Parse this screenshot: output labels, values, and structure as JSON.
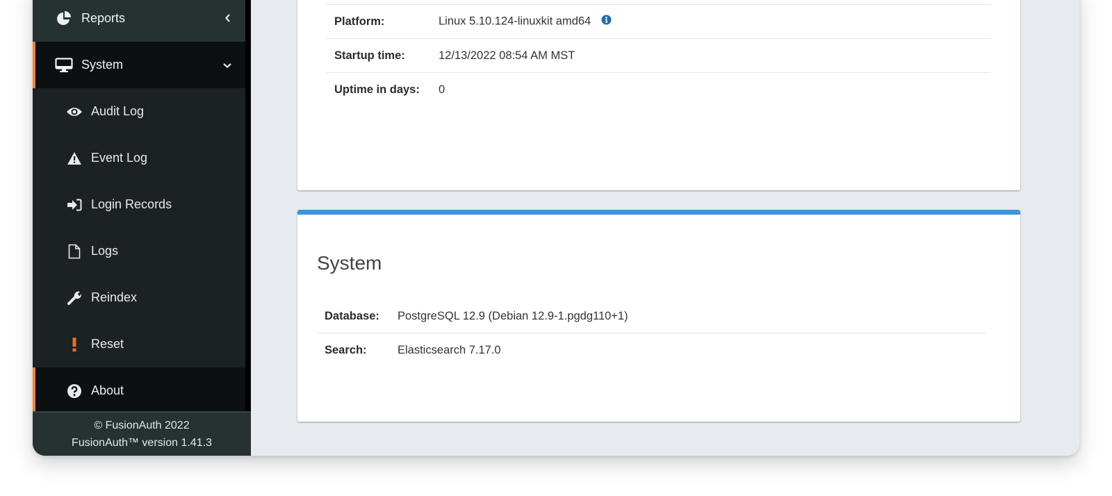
{
  "sidebar": {
    "parents": [
      {
        "label": "Reports",
        "icon": "pie-chart-icon",
        "chevron": "chevron-left-icon"
      },
      {
        "label": "System",
        "icon": "desktop-icon",
        "chevron": "chevron-down-icon"
      }
    ],
    "children": [
      {
        "label": "Audit Log",
        "icon": "eye-icon"
      },
      {
        "label": "Event Log",
        "icon": "warning-icon"
      },
      {
        "label": "Login Records",
        "icon": "sign-in-icon"
      },
      {
        "label": "Logs",
        "icon": "file-icon"
      },
      {
        "label": "Reindex",
        "icon": "wrench-icon"
      },
      {
        "label": "Reset",
        "icon": "exclamation-icon"
      },
      {
        "label": "About",
        "icon": "question-circle-icon"
      }
    ],
    "active_child": "About",
    "footer": {
      "copyright": "© FusionAuth 2022",
      "version": "FusionAuth™ version 1.41.3"
    }
  },
  "colors": {
    "accent_orange": "#f58320",
    "panel_accent_blue": "#3a97dd",
    "info_icon_blue": "#1e6bb0"
  },
  "top_panel": {
    "rows": [
      {
        "key": "Platform:",
        "value": "Linux 5.10.124-linuxkit amd64",
        "has_info_icon": true
      },
      {
        "key": "Startup time:",
        "value": "12/13/2022 08:54 AM MST"
      },
      {
        "key": "Uptime in days:",
        "value": "0"
      }
    ]
  },
  "system_panel": {
    "title": "System",
    "rows": [
      {
        "key": "Database:",
        "value": "PostgreSQL 12.9 (Debian 12.9-1.pgdg110+1)"
      },
      {
        "key": "Search:",
        "value": "Elasticsearch 7.17.0"
      }
    ]
  }
}
